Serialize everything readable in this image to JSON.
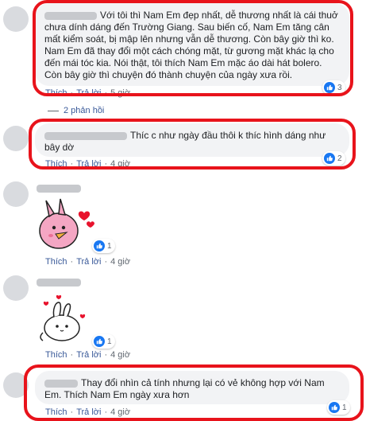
{
  "comments": [
    {
      "text": "Với tôi thì Nam Em đẹp nhất, dễ thương nhất là cái thuở chưa dính dáng đến Trường Giang. Sau biến cố, Nam Em tăng cân mất kiểm soát, bị mập lên nhưng vẫn dễ thương. Còn bây giờ thì ko. Nam Em đã thay đổi một cách chóng mặt, từ gương mặt khác lạ cho đến mái tóc kia. Nói thật, tôi thích Nam Em mặc áo dài hát bolero. Còn bây giờ thì chuyện đó thành chuyện của ngày xưa rồi.",
      "like": "Thích",
      "reply": "Trả lời",
      "time": "5 giờ",
      "reactions": "3",
      "replies_label": "2 phản hồi"
    },
    {
      "text": "Thíc c như ngày đầu thôi k thíc hình dáng như bây dờ",
      "like": "Thích",
      "reply": "Trả lời",
      "time": "4 giờ",
      "reactions": "2"
    },
    {
      "like": "Thích",
      "reply": "Trả lời",
      "time": "4 giờ",
      "reactions": "1",
      "sticker": "pink-bird-heart-sticker"
    },
    {
      "like": "Thích",
      "reply": "Trả lời",
      "time": "4 giờ",
      "reactions": "1",
      "sticker": "bunny-hearts-sticker"
    },
    {
      "text": "Thay đổi nhìn cả tính nhưng lại có vẻ không hợp với Nam Em. Thích Nam Em ngày xưa hơn",
      "like": "Thích",
      "reply": "Trả lời",
      "time": "4 giờ",
      "reactions": "1"
    }
  ],
  "colors": {
    "highlight": "#e8131b",
    "link": "#385898",
    "bubble": "#f2f3f5",
    "like_blue": "#1877f2"
  }
}
